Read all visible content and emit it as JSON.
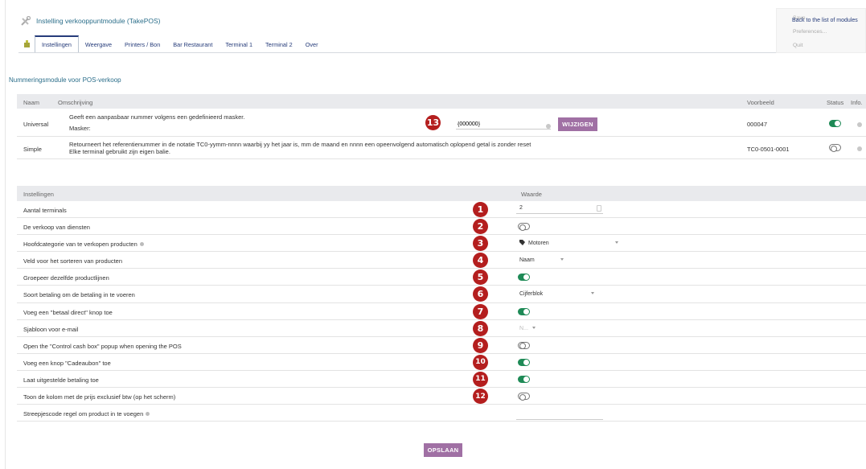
{
  "title": "Instelling verkooppuntmodule (TakePOS)",
  "tabs": [
    "Instellingen",
    "Weergave",
    "Printers / Bon",
    "Bar Restaurant",
    "Terminal 1",
    "Terminal 2",
    "Over"
  ],
  "menu": {
    "save": "Save",
    "preferences": "Preferences...",
    "quit": "Quit",
    "back": "Back to the list of modules"
  },
  "section_title": "Nummeringsmodule voor POS-verkoop",
  "numbering": {
    "headers": {
      "name": "Naam",
      "description": "Omschrijving",
      "example": "Voorbeeld",
      "status": "Status",
      "info": "Info."
    },
    "rows": [
      {
        "name": "Universal",
        "desc1": "Geeft een aanpasbaar nummer volgens een gedefinieerd masker.",
        "desc2": "Masker:",
        "mask": "{000000}",
        "button": "WIJZIGEN",
        "badge": "13",
        "example": "000047",
        "status": "on"
      },
      {
        "name": "Simple",
        "desc1": "Retourneert het referentienummer in de notatie TC0-yymm-nnnn waarbij yy het jaar is, mm de maand en nnnn een opeenvolgend automatisch oplopend getal is zonder reset",
        "desc2": "Elke terminal gebruikt zijn eigen balie.",
        "example": "TC0-0501-0001",
        "status": "off"
      }
    ]
  },
  "settings": {
    "headers": {
      "setting": "Instellingen",
      "value": "Waarde"
    },
    "rows": [
      {
        "label": "Aantal terminals",
        "badge": "1",
        "type": "number",
        "value": "2"
      },
      {
        "label": "De verkoop van diensten",
        "badge": "2",
        "type": "toggle",
        "value": "off"
      },
      {
        "label": "Hoofdcategorie van te verkopen producten",
        "help": true,
        "badge": "3",
        "type": "category",
        "value": "Motoren"
      },
      {
        "label": "Veld voor het sorteren van producten",
        "badge": "4",
        "type": "select",
        "value": "Naam"
      },
      {
        "label": "Groepeer dezelfde productlijnen",
        "badge": "5",
        "type": "toggle",
        "value": "on"
      },
      {
        "label": "Soort betaling om de betaling in te voeren",
        "badge": "6",
        "type": "select",
        "value": "Cijferblok"
      },
      {
        "label": "Voeg een \"betaal direct\" knop toe",
        "badge": "7",
        "type": "toggle",
        "value": "on"
      },
      {
        "label": "Sjabloon voor e-mail",
        "badge": "8",
        "type": "small-select",
        "value": "N..."
      },
      {
        "label": "Open the \"Control cash box\" popup when opening the POS",
        "badge": "9",
        "type": "toggle",
        "value": "off"
      },
      {
        "label": "Voeg een knop \"Cadeaubon\" toe",
        "badge": "10",
        "type": "toggle",
        "value": "on"
      },
      {
        "label": "Laat uitgestelde betaling toe",
        "badge": "11",
        "type": "toggle",
        "value": "on"
      },
      {
        "label": "Toon de kolom met de prijs exclusief btw (op het scherm)",
        "badge": "12",
        "type": "toggle",
        "value": "off"
      },
      {
        "label": "Streepjescode regel om product in te voegen",
        "help": true,
        "type": "text",
        "value": ""
      }
    ]
  },
  "save_button": "OPSLAAN",
  "colors": {
    "accent": "#a070a4",
    "toggle_on": "#1e8a56",
    "badge": "#b41e1e",
    "link": "#263c7a"
  }
}
